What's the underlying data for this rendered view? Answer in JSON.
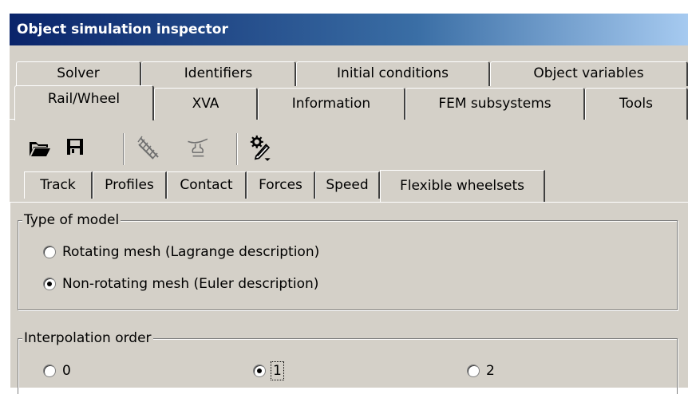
{
  "window": {
    "title": "Object simulation inspector"
  },
  "tabs_row1": [
    "Solver",
    "Identifiers",
    "Initial conditions",
    "Object variables"
  ],
  "tabs_row2": [
    "Rail/Wheel",
    "XVA",
    "Information",
    "FEM subsystems",
    "Tools"
  ],
  "active_main_tab": "Rail/Wheel",
  "toolbar": [
    "folder-open-icon",
    "save-icon",
    "track-icon",
    "wheel-profile-icon",
    "settings-edit-icon"
  ],
  "subtabs": [
    "Track",
    "Profiles",
    "Contact",
    "Forces",
    "Speed",
    "Flexible wheelsets"
  ],
  "active_subtab": "Flexible wheelsets",
  "model_group": {
    "legend": "Type of model",
    "options": [
      "Rotating mesh (Lagrange description)",
      "Non-rotating mesh (Euler description)"
    ],
    "selected": "Non-rotating mesh (Euler description)"
  },
  "interp_group": {
    "legend": "Interpolation order",
    "options": [
      "0",
      "1",
      "2"
    ],
    "selected": "1"
  }
}
